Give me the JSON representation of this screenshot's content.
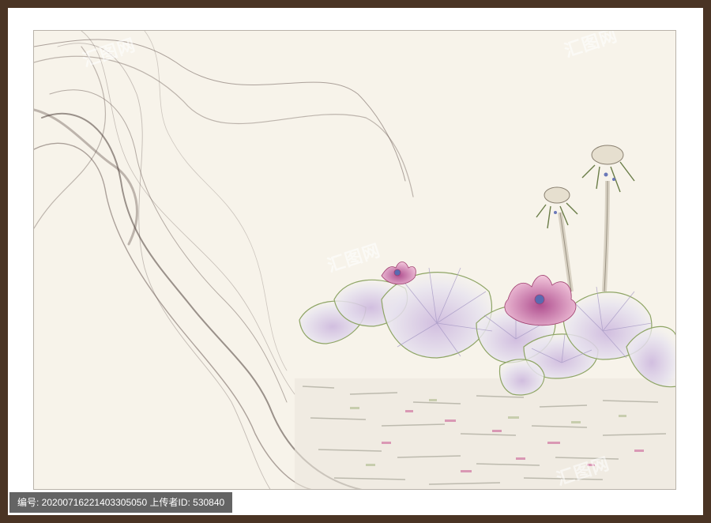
{
  "caption": {
    "text": "编号: 20200716221403305050 上传者ID: 530840"
  },
  "watermark_text": "汇图网",
  "palette": {
    "frame": "#4a3424",
    "mat": "#ffffff",
    "paper": "#f7f3ea",
    "ink": "#5a4a44",
    "lotus_pink": "#d98bb0",
    "leaf_green": "#b7c79a"
  }
}
